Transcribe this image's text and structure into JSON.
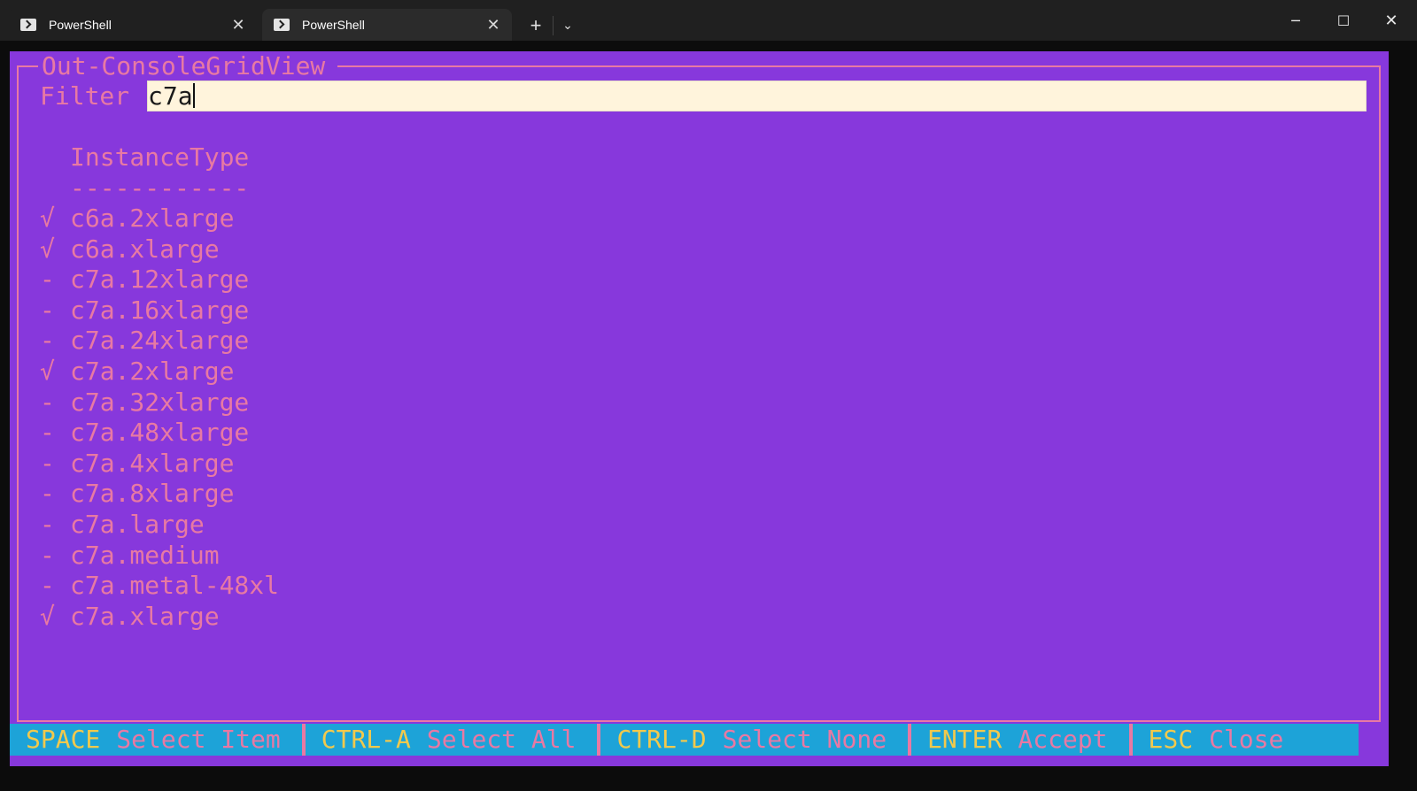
{
  "window": {
    "tabs": [
      {
        "label": "PowerShell",
        "active": false
      },
      {
        "label": "PowerShell",
        "active": true
      }
    ],
    "new_tab_glyph": "+",
    "dropdown_glyph": "⌄",
    "controls": {
      "minimize": "─",
      "maximize": "☐",
      "close": "✕"
    },
    "close_glyph": "✕"
  },
  "grid": {
    "title": "Out-ConsoleGridView",
    "filter_label": "Filter",
    "filter_value": "c7a",
    "column_header": "InstanceType",
    "column_underline": "------------",
    "rows": [
      {
        "mark": "√",
        "selected": true,
        "value": "c6a.2xlarge"
      },
      {
        "mark": "√",
        "selected": true,
        "value": "c6a.xlarge"
      },
      {
        "mark": "-",
        "selected": false,
        "value": "c7a.12xlarge"
      },
      {
        "mark": "-",
        "selected": false,
        "value": "c7a.16xlarge"
      },
      {
        "mark": "-",
        "selected": false,
        "value": "c7a.24xlarge"
      },
      {
        "mark": "√",
        "selected": true,
        "value": "c7a.2xlarge"
      },
      {
        "mark": "-",
        "selected": false,
        "value": "c7a.32xlarge"
      },
      {
        "mark": "-",
        "selected": false,
        "value": "c7a.48xlarge"
      },
      {
        "mark": "-",
        "selected": false,
        "value": "c7a.4xlarge"
      },
      {
        "mark": "-",
        "selected": false,
        "value": "c7a.8xlarge"
      },
      {
        "mark": "-",
        "selected": false,
        "value": "c7a.large"
      },
      {
        "mark": "-",
        "selected": false,
        "value": "c7a.medium"
      },
      {
        "mark": "-",
        "selected": false,
        "value": "c7a.metal-48xl"
      },
      {
        "mark": "√",
        "selected": true,
        "value": "c7a.xlarge"
      }
    ]
  },
  "statusbar": [
    {
      "key": "SPACE",
      "desc": "Select Item"
    },
    {
      "key": "CTRL-A",
      "desc": "Select All"
    },
    {
      "key": "CTRL-D",
      "desc": "Select None"
    },
    {
      "key": "ENTER",
      "desc": "Accept"
    },
    {
      "key": "ESC",
      "desc": "Close"
    }
  ],
  "colors": {
    "console_bg": "#8738dc",
    "accent_pink": "#e879a3",
    "statusbar_bg": "#1da3d8",
    "key_yellow": "#f2c94c",
    "filter_bg": "#fff4dc"
  }
}
